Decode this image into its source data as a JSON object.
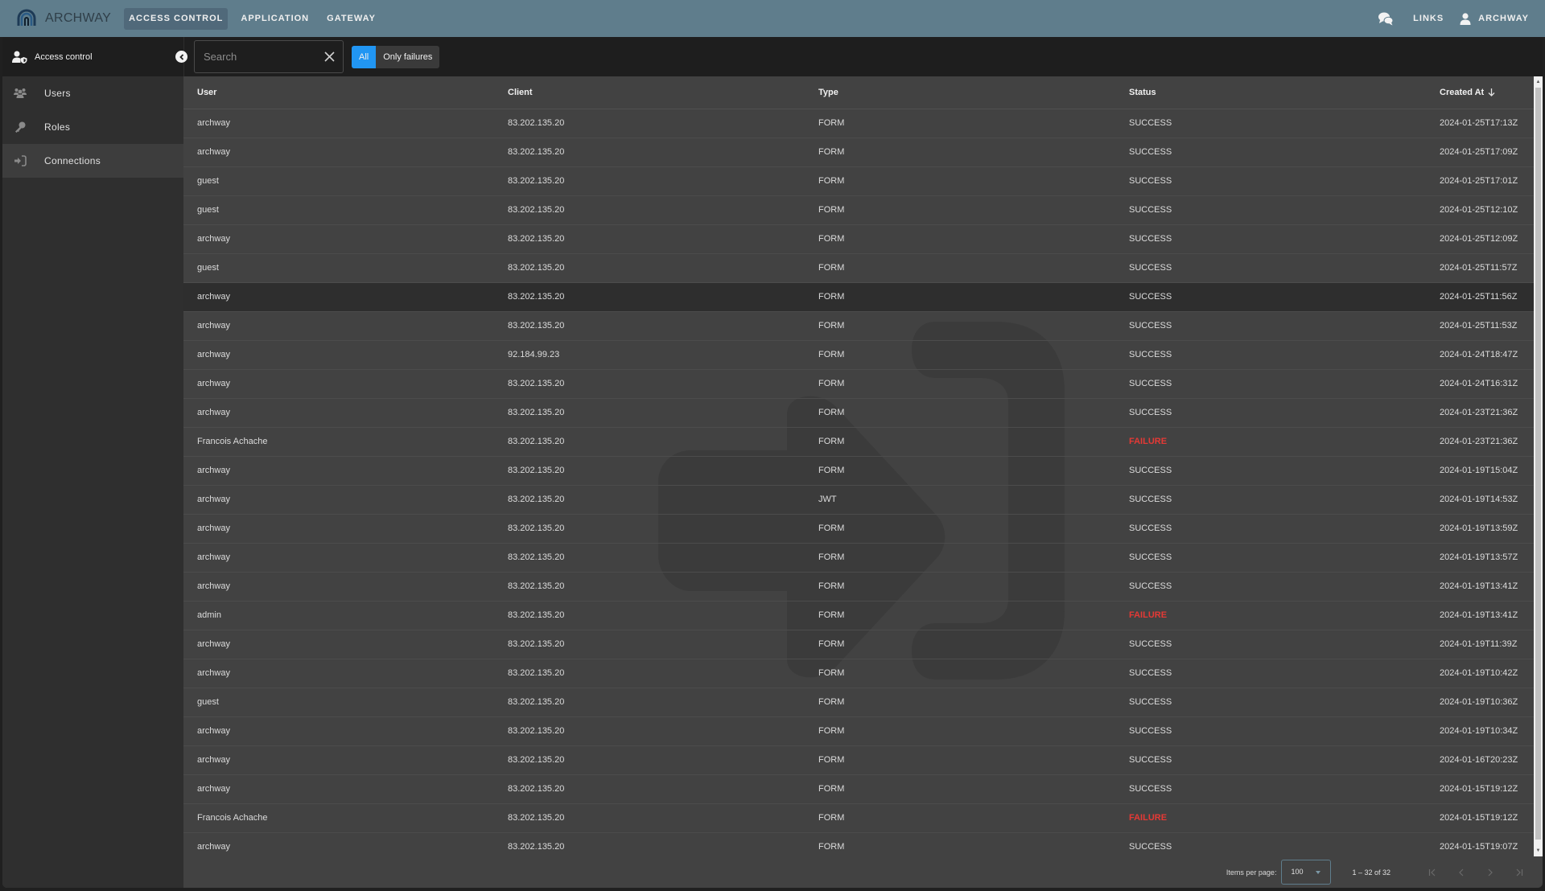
{
  "app": {
    "brand": "ARCHWAY",
    "nav": [
      {
        "label": "ACCESS CONTROL",
        "active": true
      },
      {
        "label": "APPLICATION",
        "active": false
      },
      {
        "label": "GATEWAY",
        "active": false
      }
    ],
    "links_label": "LINKS",
    "user_label": "ARCHWAY",
    "accent_color": "#2196f3",
    "failure_color": "#e53935",
    "topbar_color": "#5f7d8c"
  },
  "sidebar": {
    "title": "Access control",
    "items": [
      {
        "label": "Users",
        "icon": "users-icon",
        "active": false
      },
      {
        "label": "Roles",
        "icon": "key-icon",
        "active": false
      },
      {
        "label": "Connections",
        "icon": "sign-in-icon",
        "active": true
      }
    ]
  },
  "toolbar": {
    "search_placeholder": "Search",
    "search_value": "",
    "filter_all": "All",
    "filter_failures": "Only failures",
    "selected_filter": "All"
  },
  "table": {
    "columns": [
      "User",
      "Client",
      "Type",
      "Status",
      "Created At"
    ],
    "sort": {
      "column": "Created At",
      "direction": "desc"
    },
    "rows": [
      {
        "user": "archway",
        "client": "83.202.135.20",
        "type": "FORM",
        "status": "SUCCESS",
        "created_at": "2024-01-25T17:13Z"
      },
      {
        "user": "archway",
        "client": "83.202.135.20",
        "type": "FORM",
        "status": "SUCCESS",
        "created_at": "2024-01-25T17:09Z"
      },
      {
        "user": "guest",
        "client": "83.202.135.20",
        "type": "FORM",
        "status": "SUCCESS",
        "created_at": "2024-01-25T17:01Z"
      },
      {
        "user": "guest",
        "client": "83.202.135.20",
        "type": "FORM",
        "status": "SUCCESS",
        "created_at": "2024-01-25T12:10Z"
      },
      {
        "user": "archway",
        "client": "83.202.135.20",
        "type": "FORM",
        "status": "SUCCESS",
        "created_at": "2024-01-25T12:09Z"
      },
      {
        "user": "guest",
        "client": "83.202.135.20",
        "type": "FORM",
        "status": "SUCCESS",
        "created_at": "2024-01-25T11:57Z"
      },
      {
        "user": "archway",
        "client": "83.202.135.20",
        "type": "FORM",
        "status": "SUCCESS",
        "created_at": "2024-01-25T11:56Z",
        "highlight": true
      },
      {
        "user": "archway",
        "client": "83.202.135.20",
        "type": "FORM",
        "status": "SUCCESS",
        "created_at": "2024-01-25T11:53Z"
      },
      {
        "user": "archway",
        "client": "92.184.99.23",
        "type": "FORM",
        "status": "SUCCESS",
        "created_at": "2024-01-24T18:47Z"
      },
      {
        "user": "archway",
        "client": "83.202.135.20",
        "type": "FORM",
        "status": "SUCCESS",
        "created_at": "2024-01-24T16:31Z"
      },
      {
        "user": "archway",
        "client": "83.202.135.20",
        "type": "FORM",
        "status": "SUCCESS",
        "created_at": "2024-01-23T21:36Z"
      },
      {
        "user": "Francois Achache",
        "client": "83.202.135.20",
        "type": "FORM",
        "status": "FAILURE",
        "created_at": "2024-01-23T21:36Z"
      },
      {
        "user": "archway",
        "client": "83.202.135.20",
        "type": "FORM",
        "status": "SUCCESS",
        "created_at": "2024-01-19T15:04Z"
      },
      {
        "user": "archway",
        "client": "83.202.135.20",
        "type": "JWT",
        "status": "SUCCESS",
        "created_at": "2024-01-19T14:53Z"
      },
      {
        "user": "archway",
        "client": "83.202.135.20",
        "type": "FORM",
        "status": "SUCCESS",
        "created_at": "2024-01-19T13:59Z"
      },
      {
        "user": "archway",
        "client": "83.202.135.20",
        "type": "FORM",
        "status": "SUCCESS",
        "created_at": "2024-01-19T13:57Z"
      },
      {
        "user": "archway",
        "client": "83.202.135.20",
        "type": "FORM",
        "status": "SUCCESS",
        "created_at": "2024-01-19T13:41Z"
      },
      {
        "user": "admin",
        "client": "83.202.135.20",
        "type": "FORM",
        "status": "FAILURE",
        "created_at": "2024-01-19T13:41Z"
      },
      {
        "user": "archway",
        "client": "83.202.135.20",
        "type": "FORM",
        "status": "SUCCESS",
        "created_at": "2024-01-19T11:39Z"
      },
      {
        "user": "archway",
        "client": "83.202.135.20",
        "type": "FORM",
        "status": "SUCCESS",
        "created_at": "2024-01-19T10:42Z"
      },
      {
        "user": "guest",
        "client": "83.202.135.20",
        "type": "FORM",
        "status": "SUCCESS",
        "created_at": "2024-01-19T10:36Z"
      },
      {
        "user": "archway",
        "client": "83.202.135.20",
        "type": "FORM",
        "status": "SUCCESS",
        "created_at": "2024-01-19T10:34Z"
      },
      {
        "user": "archway",
        "client": "83.202.135.20",
        "type": "FORM",
        "status": "SUCCESS",
        "created_at": "2024-01-16T20:23Z"
      },
      {
        "user": "archway",
        "client": "83.202.135.20",
        "type": "FORM",
        "status": "SUCCESS",
        "created_at": "2024-01-15T19:12Z"
      },
      {
        "user": "Francois Achache",
        "client": "83.202.135.20",
        "type": "FORM",
        "status": "FAILURE",
        "created_at": "2024-01-15T19:12Z"
      },
      {
        "user": "archway",
        "client": "83.202.135.20",
        "type": "FORM",
        "status": "SUCCESS",
        "created_at": "2024-01-15T19:07Z"
      }
    ]
  },
  "paginator": {
    "items_per_page_label": "Items per page:",
    "items_per_page": "100",
    "range_label": "1 – 32 of 32"
  }
}
